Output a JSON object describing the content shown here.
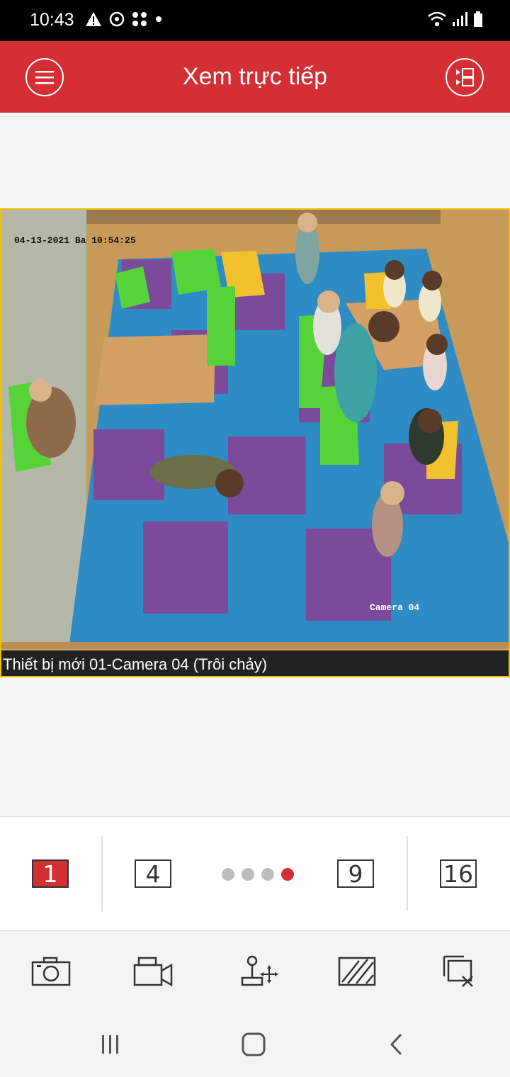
{
  "status_bar": {
    "time": "10:43",
    "icons_left": [
      "alert-icon",
      "sync-icon",
      "grid-icon",
      "dot-icon"
    ],
    "icons_right": [
      "wifi-icon",
      "signal-icon",
      "battery-icon"
    ]
  },
  "app_bar": {
    "title": "Xem trực tiếp",
    "background": "#d42f35",
    "left_icon": "menu-icon",
    "right_icon": "layout-icon"
  },
  "video": {
    "caption": "Thiết bị mới 01-Camera 04 (Trôi chảy)",
    "osd_timestamp": "04-13-2021 Ba  10:54:25",
    "osd_camera": "Camera 04",
    "border_color": "#f2c000"
  },
  "split_selector": {
    "options": [
      "1",
      "4",
      "9",
      "16"
    ],
    "selected": "1",
    "pages": 4,
    "current_page": 4
  },
  "toolbar": {
    "icons": [
      "camera-icon",
      "record-icon",
      "ptz-icon",
      "quality-icon",
      "close-all-icon"
    ]
  },
  "nav": {
    "icons": [
      "recent-apps-icon",
      "home-icon",
      "back-icon"
    ]
  }
}
